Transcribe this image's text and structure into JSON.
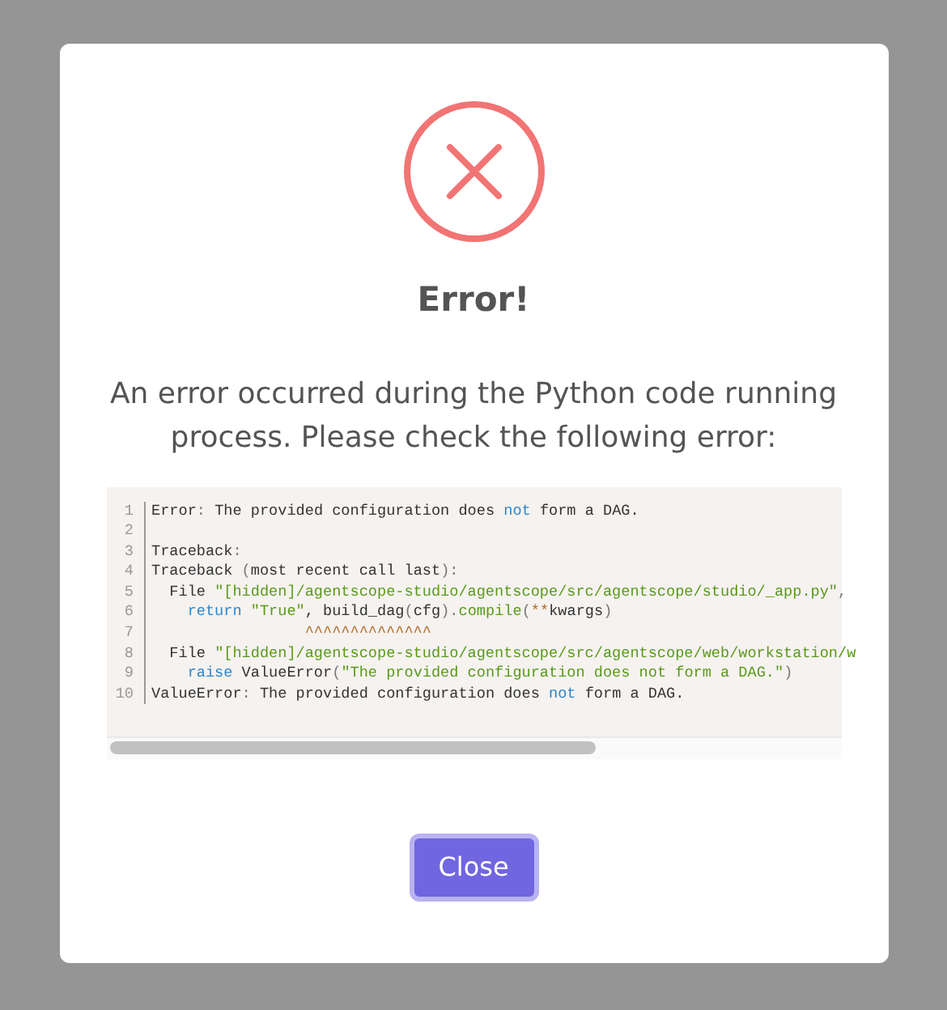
{
  "dialog": {
    "title": "Error!",
    "message": "An error occurred during the Python code running process. Please check the following error:",
    "code_lines": [
      {
        "number": "1",
        "tokens": [
          {
            "kind": "plain",
            "text": "Error"
          },
          {
            "kind": "punct",
            "text": ":"
          },
          {
            "kind": "plain",
            "text": " The provided configuration does "
          },
          {
            "kind": "keyword",
            "text": "not"
          },
          {
            "kind": "plain",
            "text": " form a DAG."
          }
        ]
      },
      {
        "number": "2"
      },
      {
        "number": "3",
        "tokens": [
          {
            "kind": "plain",
            "text": "Traceback"
          },
          {
            "kind": "punct",
            "text": ":"
          }
        ]
      },
      {
        "number": "4",
        "tokens": [
          {
            "kind": "plain",
            "text": "Traceback "
          },
          {
            "kind": "punct",
            "text": "("
          },
          {
            "kind": "plain",
            "text": "most recent call last"
          },
          {
            "kind": "punct",
            "text": "):"
          }
        ]
      },
      {
        "number": "5",
        "tokens": [
          {
            "kind": "plain",
            "text": "  File "
          },
          {
            "kind": "string",
            "text": "\"[hidden]/agentscope-studio/agentscope/src/agentscope/studio/_app.py\""
          },
          {
            "kind": "punct",
            "text": ","
          }
        ]
      },
      {
        "number": "6",
        "tokens": [
          {
            "kind": "keyword",
            "text": "    return"
          },
          {
            "kind": "string",
            "text": " \"True\""
          },
          {
            "kind": "plain",
            "text": ", build_dag"
          },
          {
            "kind": "punct",
            "text": "("
          },
          {
            "kind": "plain",
            "text": "cfg"
          },
          {
            "kind": "punct",
            "text": ")."
          },
          {
            "kind": "string",
            "text": "compile"
          },
          {
            "kind": "punct",
            "text": "("
          },
          {
            "kind": "caret",
            "text": "**"
          },
          {
            "kind": "plain",
            "text": "kwargs"
          },
          {
            "kind": "punct",
            "text": ")"
          }
        ]
      },
      {
        "number": "7",
        "tokens": [
          {
            "kind": "caret",
            "text": "                 ^^^^^^^^^^^^^^"
          }
        ]
      },
      {
        "number": "8",
        "tokens": [
          {
            "kind": "plain",
            "text": "  File "
          },
          {
            "kind": "string",
            "text": "\"[hidden]/agentscope-studio/agentscope/src/agentscope/web/workstation/w"
          }
        ]
      },
      {
        "number": "9",
        "tokens": [
          {
            "kind": "keyword",
            "text": "    raise"
          },
          {
            "kind": "plain",
            "text": " ValueError"
          },
          {
            "kind": "punct",
            "text": "("
          },
          {
            "kind": "string",
            "text": "\"The provided configuration does not form a DAG.\""
          },
          {
            "kind": "punct",
            "text": ")"
          }
        ]
      },
      {
        "number": "10",
        "tokens": [
          {
            "kind": "plain",
            "text": "ValueError"
          },
          {
            "kind": "punct",
            "text": ":"
          },
          {
            "kind": "plain",
            "text": " The provided configuration does "
          },
          {
            "kind": "keyword",
            "text": "not"
          },
          {
            "kind": "plain",
            "text": " form a DAG."
          }
        ]
      }
    ],
    "button": "Close"
  }
}
